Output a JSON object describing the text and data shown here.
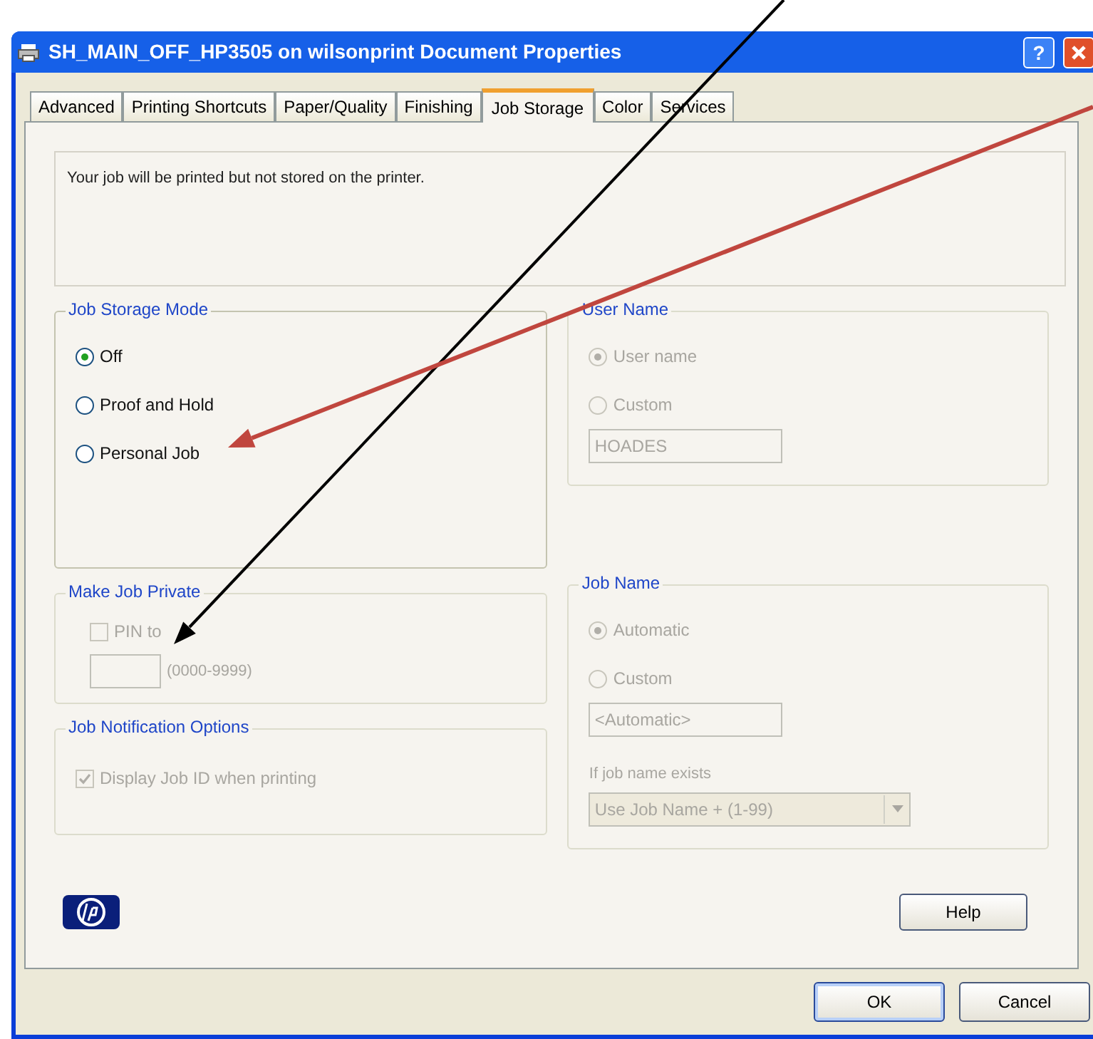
{
  "window": {
    "title": "SH_MAIN_OFF_HP3505 on wilsonprint Document Properties",
    "help_button": "?"
  },
  "tabs": [
    {
      "label": "Advanced",
      "selected": false
    },
    {
      "label": "Printing Shortcuts",
      "selected": false
    },
    {
      "label": "Paper/Quality",
      "selected": false
    },
    {
      "label": "Finishing",
      "selected": false
    },
    {
      "label": "Job Storage",
      "selected": true
    },
    {
      "label": "Color",
      "selected": false
    },
    {
      "label": "Services",
      "selected": false
    }
  ],
  "description": "Your job will be printed but not stored on the printer.",
  "job_storage_mode": {
    "title": "Job Storage Mode",
    "disabled": false,
    "options": [
      {
        "label": "Off",
        "selected": true
      },
      {
        "label": "Proof and Hold",
        "selected": false
      },
      {
        "label": "Personal Job",
        "selected": false
      }
    ]
  },
  "user_name": {
    "title": "User Name",
    "disabled": true,
    "options": [
      {
        "label": "User name",
        "selected": true
      },
      {
        "label": "Custom",
        "selected": false
      }
    ],
    "field_value": "HOADES"
  },
  "make_job_private": {
    "title": "Make Job Private",
    "disabled": true,
    "checkbox": {
      "label": "PIN to",
      "checked": false
    },
    "hint": "(0000-9999)"
  },
  "job_name": {
    "title": "Job Name",
    "disabled": true,
    "options": [
      {
        "label": "Automatic",
        "selected": true
      },
      {
        "label": "Custom",
        "selected": false
      }
    ],
    "field_value": "<Automatic>",
    "if_exists_label": "If job name exists",
    "dropdown_value": "Use Job Name + (1-99)"
  },
  "job_notification_options": {
    "title": "Job Notification Options",
    "disabled": true,
    "checkbox": {
      "label": "Display Job ID when printing",
      "checked": true
    }
  },
  "buttons": {
    "help": "Help",
    "ok": "OK",
    "cancel": "Cancel"
  }
}
